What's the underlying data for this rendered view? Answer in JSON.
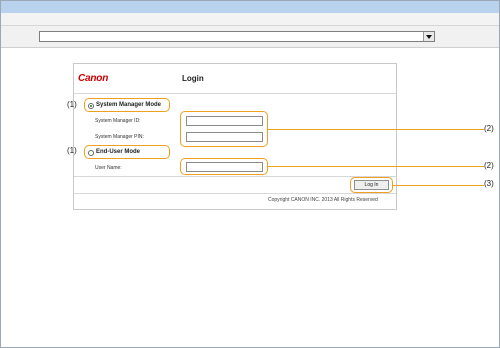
{
  "browser": {
    "address": "",
    "dropdown_icon": "chevron-down-icon"
  },
  "login_page": {
    "logo": "Canon",
    "title": "Login",
    "system_manager_mode_label": "System Manager Mode",
    "system_manager_id_label": "System Manager ID:",
    "system_manager_pin_label": "System Manager PIN:",
    "end_user_mode_label": "End-User Mode",
    "user_name_label": "User Name:",
    "login_button": "Log In",
    "copyright": "Copyright CANON INC. 2013 All Rights Reserved",
    "selected_mode": "System Manager Mode"
  },
  "callouts": {
    "mode_system": "(1)",
    "mode_enduser": "(1)",
    "system_fields": "(2)",
    "user_field": "(2)",
    "login": "(3)",
    "color": "#f0a020"
  }
}
